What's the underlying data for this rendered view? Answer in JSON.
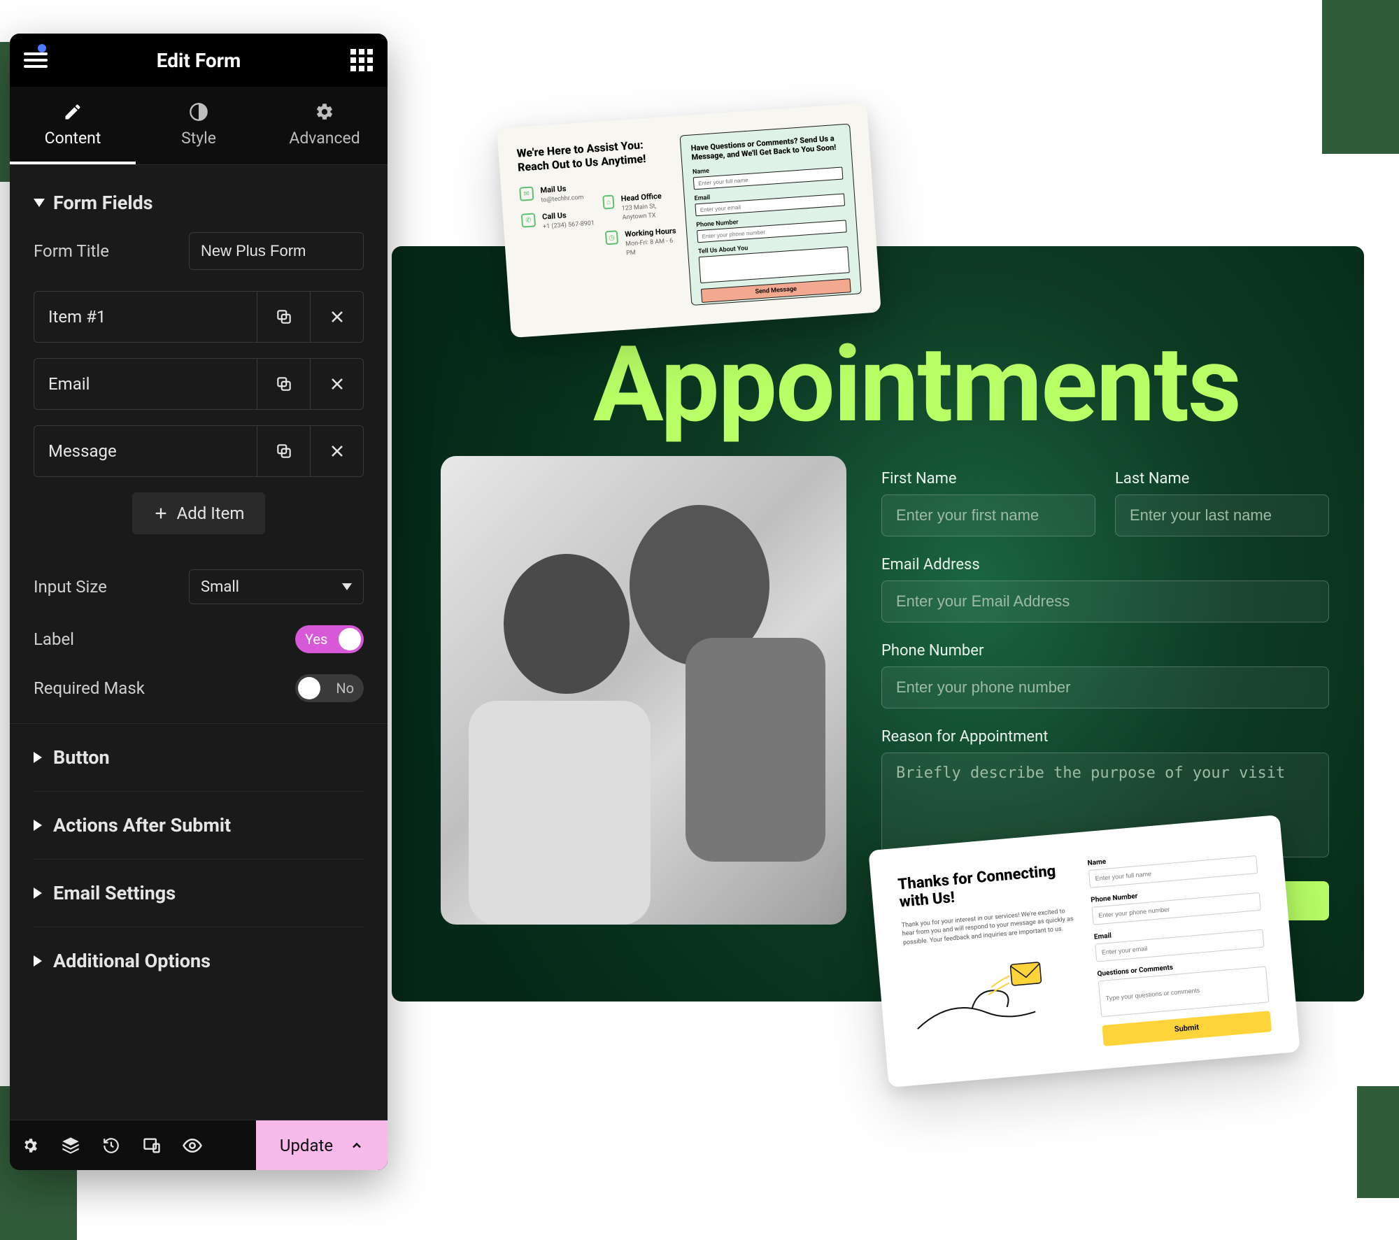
{
  "editor": {
    "title": "Edit Form",
    "tabs": {
      "content": "Content",
      "style": "Style",
      "advanced": "Advanced"
    },
    "form_fields": {
      "heading": "Form Fields",
      "form_title_label": "Form Title",
      "form_title_value": "New Plus Form",
      "items": [
        "Item #1",
        "Email",
        "Message"
      ],
      "add_item": "Add Item",
      "input_size_label": "Input Size",
      "input_size_value": "Small",
      "label_row": "Label",
      "label_toggle": "Yes",
      "required_mask_row": "Required Mask",
      "required_mask_toggle": "No"
    },
    "sections": {
      "button": "Button",
      "actions_after_submit": "Actions After Submit",
      "email_settings": "Email Settings",
      "additional_options": "Additional Options"
    },
    "footer": {
      "update": "Update"
    }
  },
  "preview": {
    "title": "Appointments",
    "fields": {
      "first_name": {
        "label": "First Name",
        "placeholder": "Enter your first name"
      },
      "last_name": {
        "label": "Last Name",
        "placeholder": "Enter your last name"
      },
      "email": {
        "label": "Email Address",
        "placeholder": "Enter your Email Address"
      },
      "phone": {
        "label": "Phone Number",
        "placeholder": "Enter your phone number"
      },
      "reason": {
        "label": "Reason for Appointment",
        "placeholder": "Briefly describe the purpose of your visit"
      }
    }
  },
  "card_top": {
    "left_heading": "We're Here to Assist You: Reach Out to Us Anytime!",
    "mail_us": "Mail Us",
    "mail_us_addr": "to@techhr.com",
    "call_us": "Call Us",
    "call_us_number": "+1 (234) 567-8901",
    "head_office": "Head Office",
    "head_office_addr": "123 Main St, Anytown TX",
    "working_hours": "Working Hours",
    "working_hours_value": "Mon-Fri: 8 AM - 6 PM",
    "right_heading": "Have Questions or Comments? Send Us a Message, and We'll Get Back to You Soon!",
    "name_label": "Name",
    "name_placeholder": "Enter your full name",
    "email_label": "Email",
    "email_placeholder": "Enter your email",
    "phone_label": "Phone Number",
    "phone_placeholder": "Enter your phone number",
    "about_label": "Tell Us About You",
    "cta": "Send Message"
  },
  "card_bottom": {
    "heading": "Thanks for Connecting with Us!",
    "body": "Thank you for your interest in our services! We're excited to hear from you and will respond to your message as quickly as possible. Your feedback and inquiries are important to us.",
    "name_label": "Name",
    "name_placeholder": "Enter your full name",
    "phone_label": "Phone Number",
    "phone_placeholder": "Enter your phone number",
    "email_label": "Email",
    "email_placeholder": "Enter your email",
    "comments_label": "Questions or Comments",
    "comments_placeholder": "Type your questions or comments",
    "cta": "Submit"
  }
}
